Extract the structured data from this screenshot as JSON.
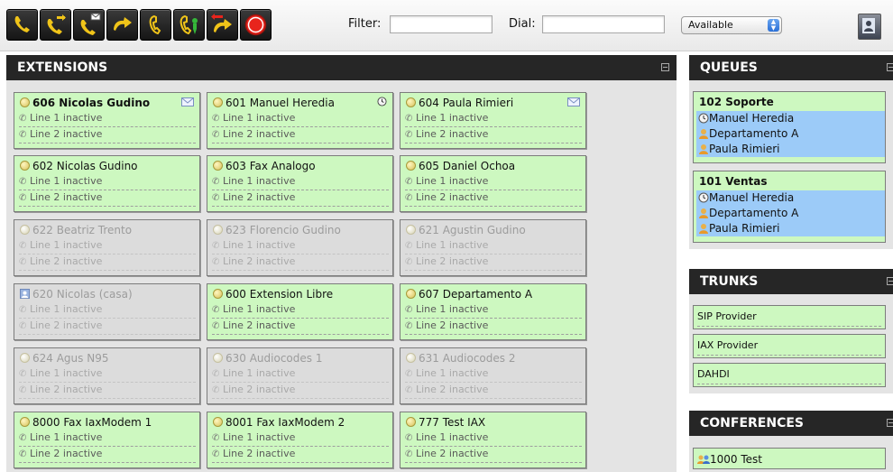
{
  "toolbar": {
    "buttons": [
      {
        "name": "call-icon"
      },
      {
        "name": "transfer-icon"
      },
      {
        "name": "voicemail-transfer-icon"
      },
      {
        "name": "pickup-icon"
      },
      {
        "name": "hangup-icon"
      },
      {
        "name": "record-icon"
      },
      {
        "name": "park-icon"
      },
      {
        "name": "stop-icon"
      }
    ],
    "filter_label": "Filter:",
    "filter_value": "",
    "dial_label": "Dial:",
    "dial_value": "",
    "status": "Available",
    "colors": {
      "button_bg": "#1e1e1e",
      "phone_yellow": "#f0c419",
      "red": "#e8241c",
      "green": "#35b83a"
    }
  },
  "extensions": {
    "title": "EXTENSIONS",
    "cards": [
      {
        "label": "606 Nicolas Gudino",
        "line1": "Line 1 inactive",
        "line2": "Line 2 inactive",
        "state": "active",
        "bold": true,
        "icon": "mail-icon"
      },
      {
        "label": "601 Manuel Heredia",
        "line1": "Line 1 inactive",
        "line2": "Line 2 inactive",
        "state": "active",
        "icon": "clock-icon"
      },
      {
        "label": "604 Paula Rimieri",
        "line1": "Line 1 inactive",
        "line2": "Line 2 inactive",
        "state": "active",
        "icon": "mail-icon"
      },
      {
        "label": "602 Nicolas Gudino",
        "line1": "Line 1 inactive",
        "line2": "Line 2 inactive",
        "state": "active"
      },
      {
        "label": "603 Fax Analogo",
        "line1": "Line 1 inactive",
        "line2": "Line 2 inactive",
        "state": "active"
      },
      {
        "label": "605 Daniel Ochoa",
        "line1": "Line 1 inactive",
        "line2": "Line 2 inactive",
        "state": "active"
      },
      {
        "label": "622 Beatriz Trento",
        "line1": "Line 1 inactive",
        "line2": "Line 2 inactive",
        "state": "inactive"
      },
      {
        "label": "623 Florencio Gudino",
        "line1": "Line 1 inactive",
        "line2": "Line 2 inactive",
        "state": "inactive"
      },
      {
        "label": "621 Agustin Gudino",
        "line1": "Line 1 inactive",
        "line2": "Line 2 inactive",
        "state": "inactive"
      },
      {
        "label": "620 Nicolas (casa)",
        "line1": "Line 1 inactive",
        "line2": "Line 2 inactive",
        "state": "inactive",
        "lead": "contact-icon"
      },
      {
        "label": "600 Extension Libre",
        "line1": "Line 1 inactive",
        "line2": "Line 2 inactive",
        "state": "active"
      },
      {
        "label": "607 Departamento A",
        "line1": "Line 1 inactive",
        "line2": "Line 2 inactive",
        "state": "active"
      },
      {
        "label": "624 Agus N95",
        "line1": "Line 1 inactive",
        "line2": "Line 2 inactive",
        "state": "inactive"
      },
      {
        "label": "630 Audiocodes 1",
        "line1": "Line 1 inactive",
        "line2": "Line 2 inactive",
        "state": "inactive"
      },
      {
        "label": "631 Audiocodes 2",
        "line1": "Line 1 inactive",
        "line2": "Line 2 inactive",
        "state": "inactive"
      },
      {
        "label": "8000 Fax IaxModem 1",
        "line1": "Line 1 inactive",
        "line2": "Line 2 inactive",
        "state": "active"
      },
      {
        "label": "8001 Fax IaxModem 2",
        "line1": "Line 1 inactive",
        "line2": "Line 2 inactive",
        "state": "active"
      },
      {
        "label": "777 Test IAX",
        "line1": "Line 1 inactive",
        "line2": "Line 2 inactive",
        "state": "active"
      }
    ]
  },
  "queues": {
    "title": "QUEUES",
    "items": [
      {
        "name": "102 Soporte",
        "members": [
          {
            "label": "Manuel Heredia",
            "icon": "clock-icon"
          },
          {
            "label": "Departamento A",
            "icon": "agent-icon"
          },
          {
            "label": "Paula Rimieri",
            "icon": "agent-icon"
          }
        ]
      },
      {
        "name": "101 Ventas",
        "members": [
          {
            "label": "Manuel Heredia",
            "icon": "clock-icon"
          },
          {
            "label": "Departamento A",
            "icon": "agent-icon"
          },
          {
            "label": "Paula Rimieri",
            "icon": "agent-icon"
          }
        ]
      }
    ]
  },
  "trunks": {
    "title": "TRUNKS",
    "items": [
      "SIP Provider",
      "IAX Provider",
      "DAHDI"
    ]
  },
  "conferences": {
    "title": "CONFERENCES",
    "items": [
      "1000 Test"
    ]
  },
  "colors": {
    "active_card": "#cdf8c0",
    "inactive_card": "#dcdcdc",
    "queue_member_bg": "#9ccbf8",
    "header_bg": "#262626",
    "panel_bg": "#e4e4e4"
  }
}
